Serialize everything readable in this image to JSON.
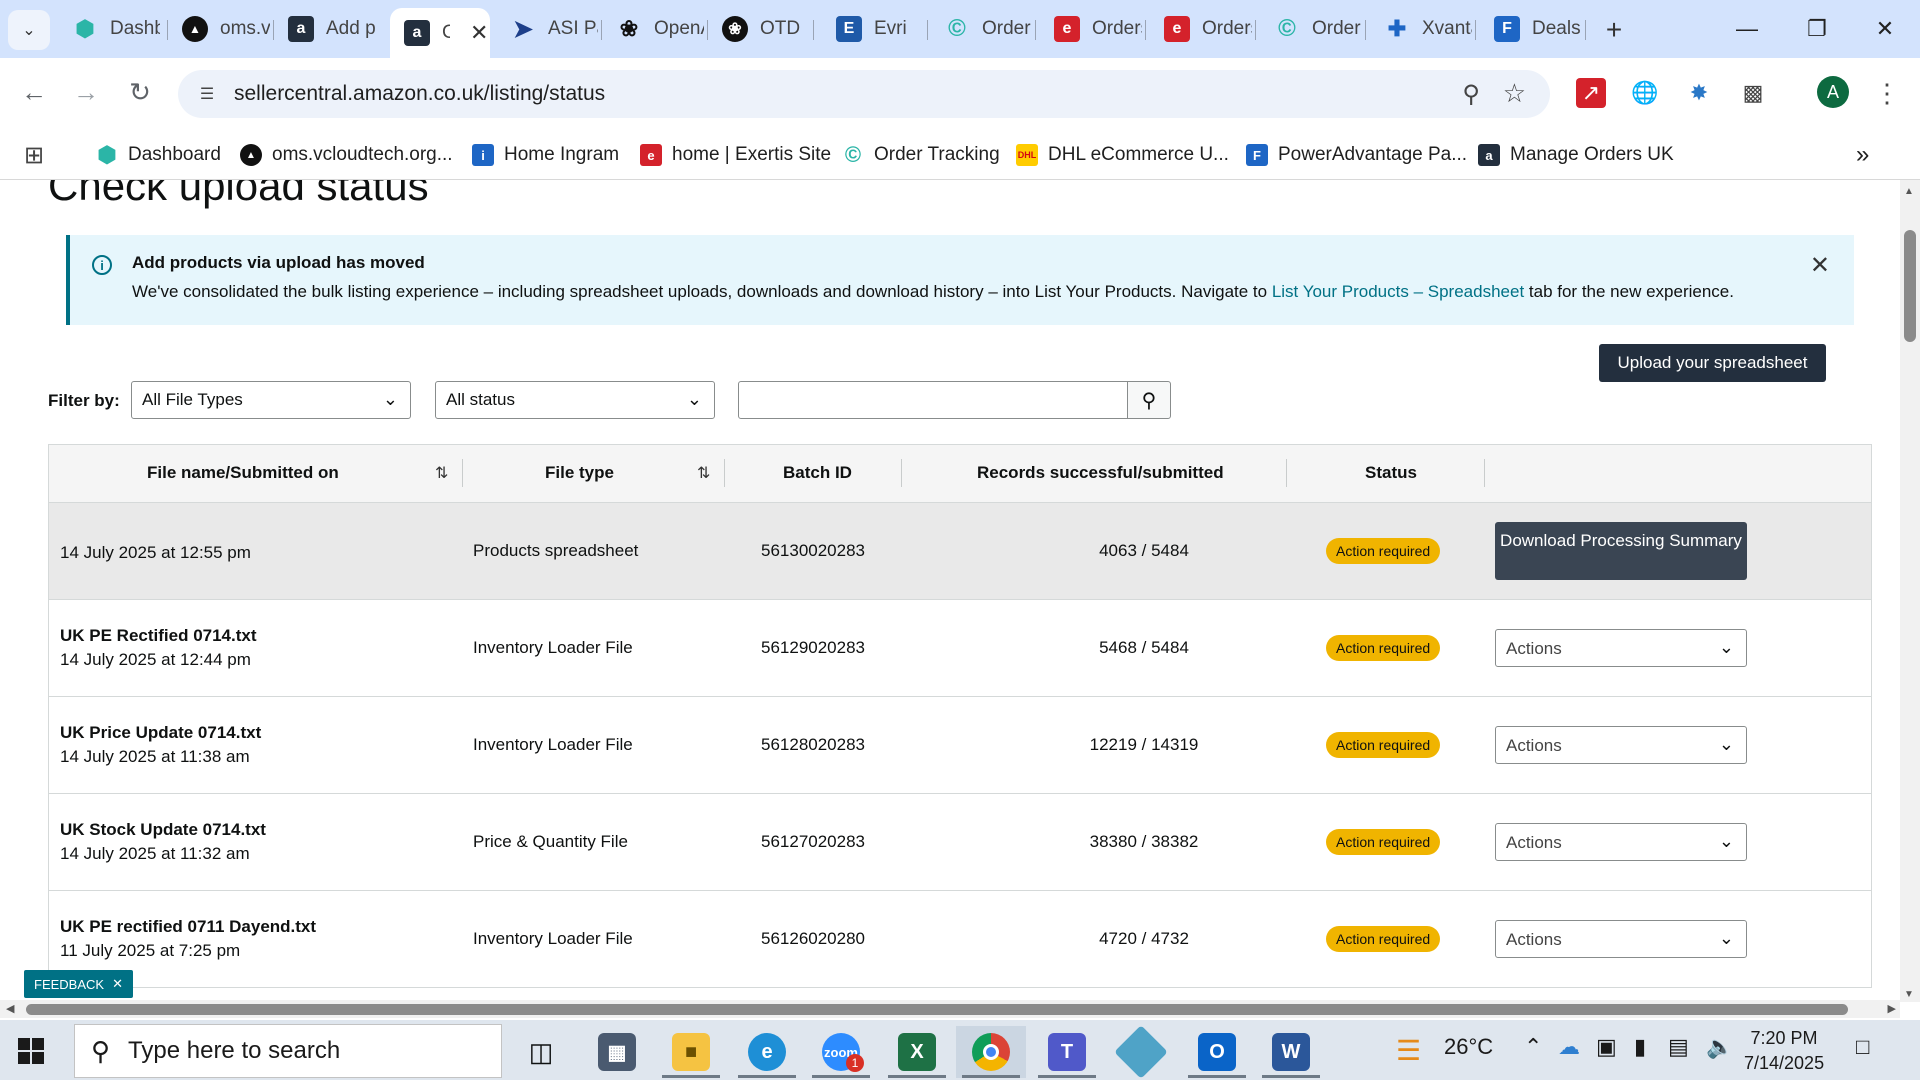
{
  "browser": {
    "tabs": [
      {
        "title": "Dashboard",
        "icon": "hexagon-icon",
        "color": "#2bb5a7"
      },
      {
        "title": "oms.vcloudtech",
        "icon": "triangle-icon",
        "color": "#111111"
      },
      {
        "title": "Add products",
        "icon": "amazon-icon",
        "color": "#232f3e"
      },
      {
        "title": "Check upload status",
        "icon": "amazon-icon",
        "color": "#232f3e",
        "active": true
      },
      {
        "title": "ASI Partner",
        "icon": "arrow-icon",
        "color": "#1d3f8a"
      },
      {
        "title": "OpenAI",
        "icon": "openai-icon",
        "color": "#111111"
      },
      {
        "title": "OTD",
        "icon": "openai-icon",
        "color": "#111111"
      },
      {
        "title": "Evri",
        "icon": "e-icon",
        "color": "#1f5aa8"
      },
      {
        "title": "Order Tracking",
        "icon": "c-icon",
        "color": "#2bb5a7"
      },
      {
        "title": "Orders",
        "icon": "exertis-icon",
        "color": "#d4222b"
      },
      {
        "title": "Orders",
        "icon": "exertis-icon",
        "color": "#d4222b"
      },
      {
        "title": "Order Tracking",
        "icon": "c-icon",
        "color": "#2bb5a7"
      },
      {
        "title": "Xvantage",
        "icon": "x-icon",
        "color": "#1e66c5"
      },
      {
        "title": "Deals",
        "icon": "f-icon",
        "color": "#1e66c5"
      }
    ],
    "url": "sellercentral.amazon.co.uk/listing/status",
    "avatar_letter": "A",
    "bookmarks": [
      {
        "label": "Dashboard",
        "color": "#2bb5a7"
      },
      {
        "label": "oms.vcloudtech.org...",
        "color": "#111111"
      },
      {
        "label": "Home Ingram",
        "color": "#1e66c5"
      },
      {
        "label": "home | Exertis Site",
        "color": "#d4222b"
      },
      {
        "label": "Order Tracking",
        "color": "#2bb5a7"
      },
      {
        "label": "DHL eCommerce U...",
        "color": "#ffcc00"
      },
      {
        "label": "PowerAdvantage Pa...",
        "color": "#1e66c5"
      },
      {
        "label": "Manage Orders UK",
        "color": "#232f3e"
      }
    ]
  },
  "page": {
    "title": "Check upload status",
    "alert": {
      "heading": "Add products via upload has moved",
      "body_prefix": "We've consolidated the bulk listing experience – including spreadsheet uploads, downloads and download history – into List Your Products. Navigate to ",
      "link": "List Your Products – Spreadsheet",
      "body_suffix": " tab for the new experience."
    },
    "upload_button": "Upload your spreadsheet",
    "filter_label": "Filter by:",
    "file_type_filter": "All File Types",
    "status_filter": "All status",
    "search_value": "",
    "columns": [
      "File name/Submitted on",
      "File type",
      "Batch ID",
      "Records successful/submitted",
      "Status"
    ],
    "rows": [
      {
        "name": "",
        "date": "14 July 2025 at 12:55 pm",
        "type": "Products spreadsheet",
        "batch": "56130020283",
        "records": "4063 / 5484",
        "status": "Action required",
        "action": "Download Processing Summary"
      },
      {
        "name": "UK PE Rectified 0714.txt",
        "date": "14 July 2025 at 12:44 pm",
        "type": "Inventory Loader File",
        "batch": "56129020283",
        "records": "5468 / 5484",
        "status": "Action required",
        "action": "Actions"
      },
      {
        "name": "UK Price Update 0714.txt",
        "date": "14 July 2025 at 11:38 am",
        "type": "Inventory Loader File",
        "batch": "56128020283",
        "records": "12219 / 14319",
        "status": "Action required",
        "action": "Actions"
      },
      {
        "name": "UK Stock Update 0714.txt",
        "date": "14 July 2025 at 11:32 am",
        "type": "Price & Quantity File",
        "batch": "56127020283",
        "records": "38380 / 38382",
        "status": "Action required",
        "action": "Actions"
      },
      {
        "name": "UK PE rectified 0711 Dayend.txt",
        "date": "11 July 2025 at 7:25 pm",
        "type": "Inventory Loader File",
        "batch": "56126020280",
        "records": "4720 / 4732",
        "status": "Action required",
        "action": "Actions"
      }
    ],
    "feedback_label": "FEEDBACK"
  },
  "taskbar": {
    "search_placeholder": "Type here to search",
    "temperature": "26°C",
    "time": "7:20 PM",
    "date": "7/14/2025",
    "zoom_badge": "1"
  }
}
